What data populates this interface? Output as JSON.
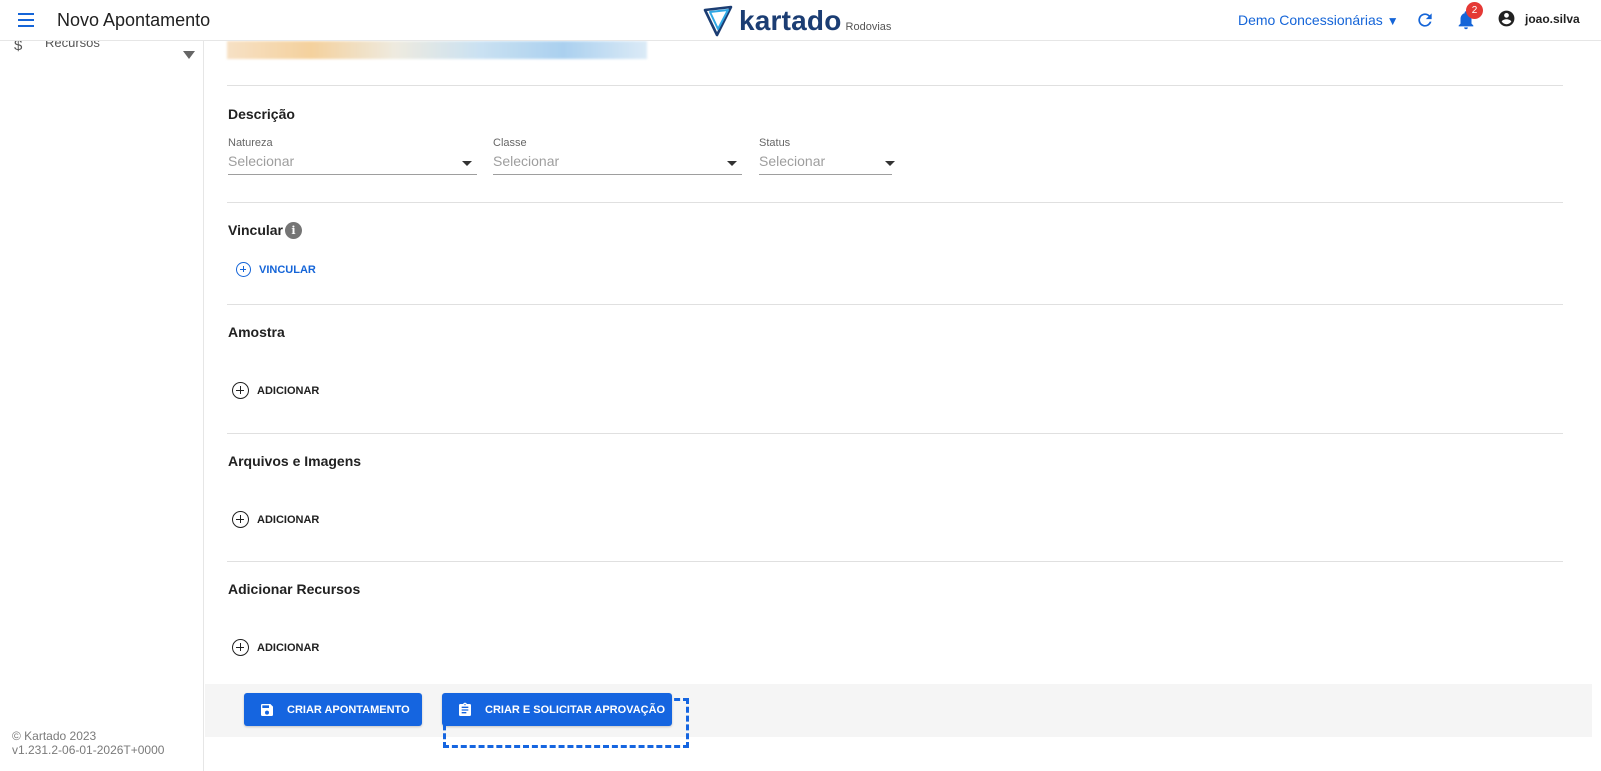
{
  "header": {
    "title": "Novo Apontamento",
    "logo_text": "kartado",
    "logo_sub": "Rodovias",
    "org": "Demo Concessionárias",
    "org_caret": "▼",
    "notification_count": "2",
    "user": "joao.silva"
  },
  "sidebar": {
    "item_label": "Recursos",
    "item_icon": "$",
    "footer_copyright": "© Kartado 2023",
    "footer_version": "v1.231.2-06-01-2026T+0000"
  },
  "sections": {
    "descricao": {
      "title": "Descrição",
      "fields": [
        {
          "label": "Natureza",
          "value": "Selecionar"
        },
        {
          "label": "Classe",
          "value": "Selecionar"
        },
        {
          "label": "Status",
          "value": "Selecionar"
        }
      ]
    },
    "vincular": {
      "title": "Vincular",
      "button": "VINCULAR"
    },
    "amostra": {
      "title": "Amostra",
      "button": "ADICIONAR"
    },
    "arquivos": {
      "title": "Arquivos e Imagens",
      "button": "ADICIONAR"
    },
    "recursos": {
      "title": "Adicionar Recursos",
      "button": "ADICIONAR"
    }
  },
  "actions": {
    "create": "CRIAR APONTAMENTO",
    "create_approval": "CRIAR E SOLICITAR APROVAÇÃO"
  },
  "colors": {
    "accent": "#1565e0",
    "badge": "#e53935",
    "logo": "#1b3d73"
  },
  "icons": {
    "menu": "menu-icon",
    "refresh": "refresh-icon",
    "bell": "bell-icon",
    "account": "account-circle-icon",
    "save": "save-icon",
    "clipboard": "clipboard-icon",
    "info": "info-icon",
    "add": "add-circle-icon"
  }
}
